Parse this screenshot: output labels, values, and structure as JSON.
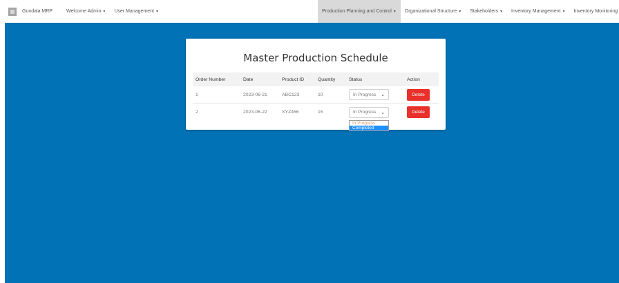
{
  "navbar": {
    "brand": "Gundala MRP",
    "welcome": "Welcome Admin",
    "user_management": "User Management",
    "production_planning": "Production Planning and Control",
    "organizational_structure": "Organizational Structure",
    "stakeholders": "Stakeholders",
    "inventory_management": "Inventory Management",
    "inventory_monitoring": "Inventory Monitoring"
  },
  "card": {
    "title": "Master Production Schedule"
  },
  "table": {
    "headers": {
      "order_number": "Order Number",
      "date": "Date",
      "product_id": "Product ID",
      "quantity": "Quantity",
      "status": "Status",
      "action": "Action"
    },
    "rows": [
      {
        "order_number": "1",
        "date": "2023-06-21",
        "product_id": "ABC123",
        "quantity": "10",
        "status": "In Progress",
        "action": "Delete"
      },
      {
        "order_number": "2",
        "date": "2023-06-22",
        "product_id": "XYZ456",
        "quantity": "15",
        "status": "In Progress",
        "action": "Delete"
      }
    ]
  },
  "dropdown": {
    "options": [
      "In Progress",
      "Completed"
    ],
    "highlighted": "Completed"
  },
  "colors": {
    "background_blue": "#0072b5",
    "delete_red": "#e9302a",
    "selected_option": "#1e90ff",
    "active_nav": "#d9d9d9"
  },
  "icons": {
    "brand": "app-logo-icon",
    "caret": "caret-down-icon",
    "select_chevron": "chevron-down-icon"
  }
}
